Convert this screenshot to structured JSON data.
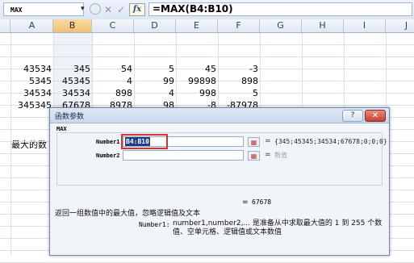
{
  "formula_bar": {
    "name_box": "MAX",
    "dropdown_glyph": "▾",
    "cancel_glyph": "✕",
    "enter_glyph": "✓",
    "fx_label": "fx",
    "formula": "=MAX(B4:B10)"
  },
  "columns": [
    "A",
    "B",
    "C",
    "D",
    "E",
    "F",
    "G",
    "H",
    "I",
    "J"
  ],
  "selected_column": "B",
  "rows": [
    [
      "43534",
      "345",
      "54",
      "5",
      "45",
      "-3"
    ],
    [
      "5345",
      "45345",
      "4",
      "99",
      "99898",
      "898"
    ],
    [
      "34534",
      "34534",
      "898",
      "4",
      "998",
      "5"
    ],
    [
      "345345",
      "67678",
      "8978",
      "98",
      "-8",
      "-87978"
    ]
  ],
  "row_label": "最大的数",
  "dialog": {
    "title": "函数参数",
    "help_glyph": "?",
    "close_glyph": "✕",
    "function_name": "MAX",
    "arg1_label": "Number1",
    "arg1_value": "B4:B10",
    "arg1_result": "{345;45345;34534;67678;0;0;0}",
    "arg2_label": "Number2",
    "arg2_value": "",
    "arg2_result": "数值",
    "eq_sign": "=",
    "result_value": "67678",
    "description": "返回一组数值中的最大值，忽略逻辑值及文本",
    "arg_help_name": "Number1:",
    "arg_help_text": "number1,number2,... 是准备从中求取最大值的 1 到 255 个数值、空单元格、逻辑值或文本数值"
  },
  "icons": {
    "collapse": "collapse-dialog-icon"
  },
  "colors": {
    "selected_header": "#f2c173",
    "highlight_box": "#d9302c",
    "selection_fill": "#1c3f86",
    "close_button": "#c4412f"
  }
}
